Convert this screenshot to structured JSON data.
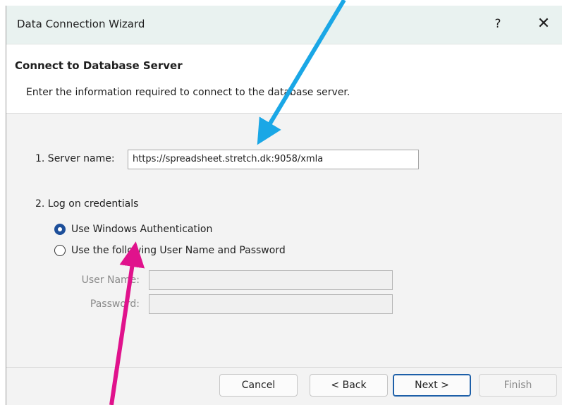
{
  "window": {
    "title": "Data Connection Wizard",
    "help_glyph": "?",
    "close_glyph": "✕"
  },
  "step": {
    "title": "Connect to Database Server",
    "description": "Enter the information required to connect to the database server."
  },
  "server": {
    "label": "1. Server name:",
    "value": "https://spreadsheet.stretch.dk:9058/xmla"
  },
  "credentials": {
    "section_label": "2. Log on credentials",
    "options": [
      {
        "label": "Use Windows Authentication",
        "selected": true
      },
      {
        "label": "Use the following User Name and Password",
        "selected": false
      }
    ],
    "username_label": "User Name:",
    "password_label": "Password:",
    "username_value": "",
    "password_value": ""
  },
  "buttons": {
    "cancel": "Cancel",
    "back": "< Back",
    "next": "Next >",
    "finish": "Finish"
  },
  "annotations": {
    "blue_arrow_color": "#1aa7e6",
    "magenta_arrow_color": "#e0128c"
  }
}
